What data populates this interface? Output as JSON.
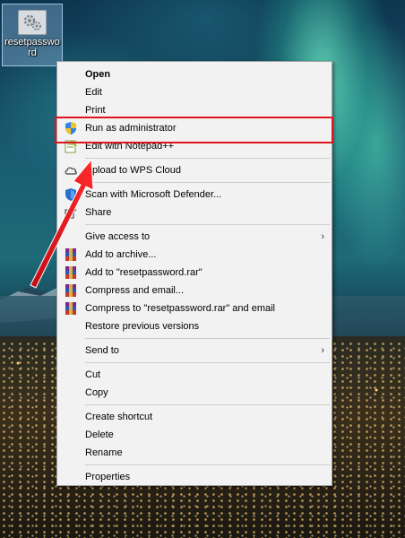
{
  "desktop": {
    "icon_label": "resetpassword",
    "icon_name": "settings-file-icon"
  },
  "menu": {
    "items": [
      {
        "label": "Open",
        "bold": true
      },
      {
        "label": "Edit"
      },
      {
        "label": "Print"
      },
      {
        "label": "Run as administrator",
        "icon": "uac-shield-icon"
      },
      {
        "label": "Edit with Notepad++",
        "icon": "notepadpp-icon"
      },
      {
        "label": "Upload to WPS Cloud",
        "icon": "cloud-icon"
      },
      {
        "label": "Scan with Microsoft Defender...",
        "icon": "defender-icon"
      },
      {
        "label": "Share",
        "icon": "share-icon"
      },
      {
        "label": "Give access to",
        "submenu": true
      },
      {
        "label": "Add to archive...",
        "icon": "winrar-icon"
      },
      {
        "label": "Add to \"resetpassword.rar\"",
        "icon": "winrar-icon"
      },
      {
        "label": "Compress and email...",
        "icon": "winrar-icon"
      },
      {
        "label": "Compress to \"resetpassword.rar\" and email",
        "icon": "winrar-icon"
      },
      {
        "label": "Restore previous versions"
      },
      {
        "label": "Send to",
        "submenu": true
      },
      {
        "label": "Cut"
      },
      {
        "label": "Copy"
      },
      {
        "label": "Create shortcut"
      },
      {
        "label": "Delete"
      },
      {
        "label": "Rename"
      },
      {
        "label": "Properties"
      }
    ],
    "submenu_arrow": "›"
  },
  "annotation": {
    "highlight_color": "#e0141e",
    "highlighted_item": "Run as administrator"
  }
}
